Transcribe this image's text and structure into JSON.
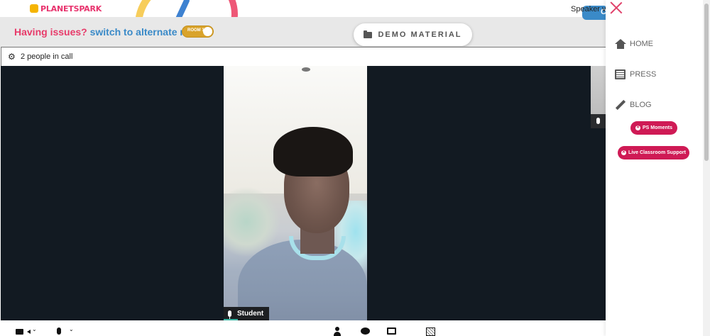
{
  "brand": {
    "logo_text_a": "PLANET",
    "logo_text_b": "SPARK"
  },
  "banner": {
    "issue_question": "Having issues?",
    "issue_switch": "switch to alternate room",
    "toggle_label": "ROOM 1",
    "demo_material_label": "DEMO MATERIAL",
    "chat_bubble_text": "C"
  },
  "call": {
    "people_count_text": "2 people in call",
    "view_mode": "Speaker vi"
  },
  "video": {
    "participant_name": "Student"
  },
  "side_panel": {
    "nav": [
      {
        "label": "HOME",
        "icon": "home-icon"
      },
      {
        "label": "PRESS",
        "icon": "press-icon"
      },
      {
        "label": "BLOG",
        "icon": "pencil-icon"
      }
    ],
    "pills": [
      {
        "label": "PS Moments"
      },
      {
        "label": "Live Classroom Support"
      }
    ]
  },
  "colors": {
    "accent_pink": "#e73b6a",
    "accent_blue": "#3a8ac8",
    "pill_red": "#cf1a55",
    "toggle_gold": "#d9a32b",
    "video_bg": "#121a22"
  }
}
